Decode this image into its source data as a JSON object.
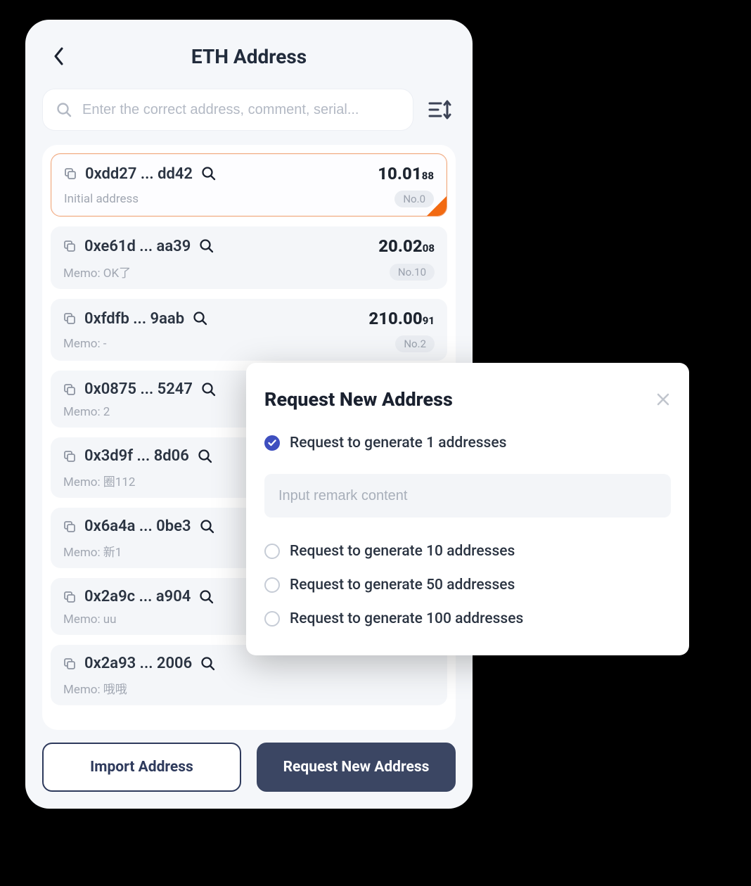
{
  "header": {
    "title": "ETH Address"
  },
  "search": {
    "placeholder": "Enter the correct address, comment, serial...",
    "value": ""
  },
  "addresses": [
    {
      "addr": "0xdd27 ... dd42",
      "balance_major": "10.01",
      "balance_minor": "88",
      "memo": "Initial address",
      "no": "No.0",
      "selected": true
    },
    {
      "addr": "0xe61d ... aa39",
      "balance_major": "20.02",
      "balance_minor": "08",
      "memo": "Memo: OK了",
      "no": "No.10",
      "selected": false
    },
    {
      "addr": "0xfdfb ... 9aab",
      "balance_major": "210.00",
      "balance_minor": "91",
      "memo": "Memo: -",
      "no": "No.2",
      "selected": false
    },
    {
      "addr": "0x0875 ... 5247",
      "balance_major": "",
      "balance_minor": "",
      "memo": "Memo: 2",
      "no": "",
      "selected": false
    },
    {
      "addr": "0x3d9f ... 8d06",
      "balance_major": "",
      "balance_minor": "",
      "memo": "Memo: 圈112",
      "no": "",
      "selected": false
    },
    {
      "addr": "0x6a4a ... 0be3",
      "balance_major": "",
      "balance_minor": "",
      "memo": "Memo: 新1",
      "no": "",
      "selected": false
    },
    {
      "addr": "0x2a9c ... a904",
      "balance_major": "",
      "balance_minor": "",
      "memo": "Memo: uu",
      "no": "",
      "selected": false
    },
    {
      "addr": "0x2a93 ... 2006",
      "balance_major": "",
      "balance_minor": "",
      "memo": "Memo: 哦哦",
      "no": "",
      "selected": false
    }
  ],
  "footer": {
    "import_label": "Import Address",
    "request_label": "Request New Address"
  },
  "modal": {
    "title": "Request New Address",
    "remark_placeholder": "Input remark content",
    "options": [
      {
        "label": "Request to generate 1 addresses",
        "checked": true
      },
      {
        "label": "Request to generate 10 addresses",
        "checked": false
      },
      {
        "label": "Request to generate 50 addresses",
        "checked": false
      },
      {
        "label": "Request to generate 100 addresses",
        "checked": false
      }
    ]
  }
}
